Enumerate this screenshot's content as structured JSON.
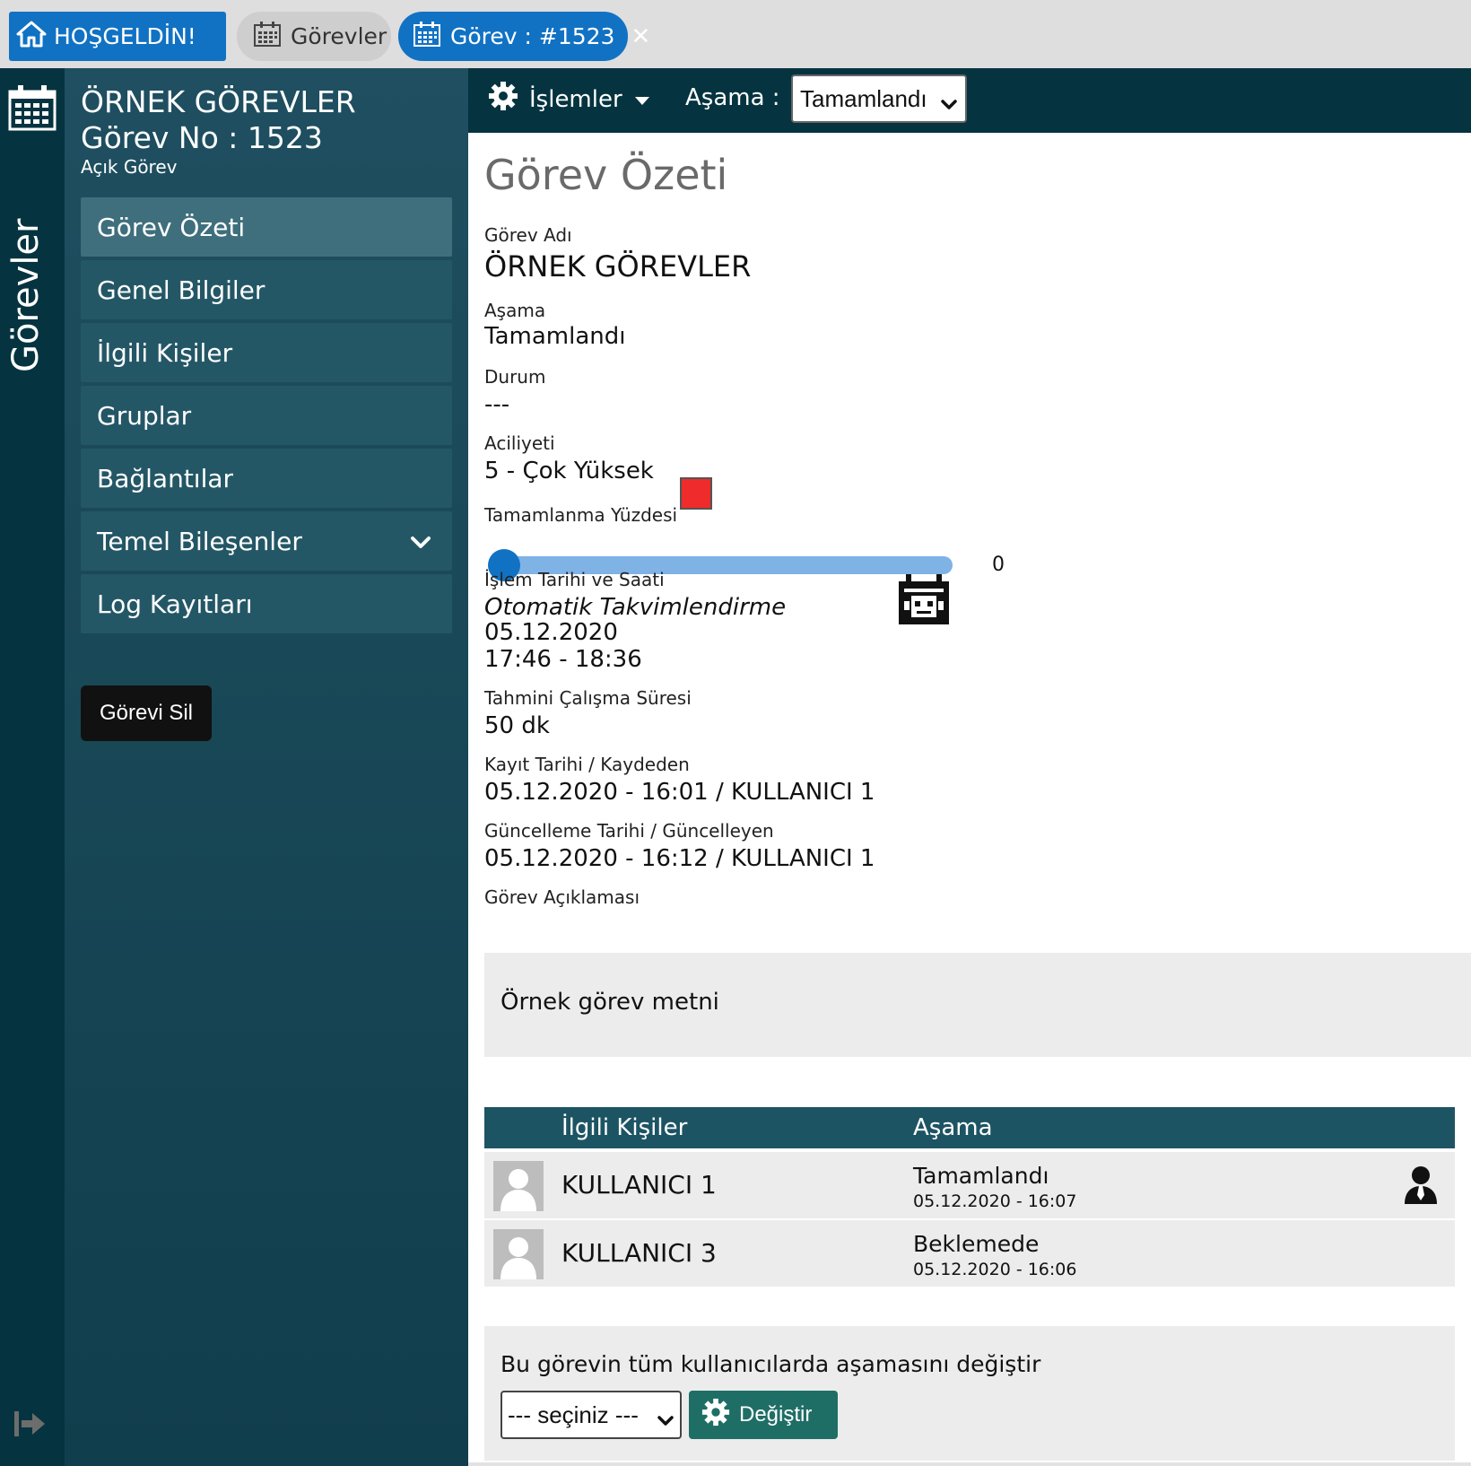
{
  "tabs": {
    "home_label": "HOŞGELDİN!",
    "tasks_label": "Görevler",
    "active_label": "Görev : #1523"
  },
  "rail": {
    "title": "Görevler"
  },
  "sidebar": {
    "task_name": "ÖRNEK GÖREVLER",
    "task_no": "Görev No : 1523",
    "task_state": "Açık Görev",
    "menu": [
      {
        "label": "Görev Özeti"
      },
      {
        "label": "Genel Bilgiler"
      },
      {
        "label": "İlgili Kişiler"
      },
      {
        "label": "Gruplar"
      },
      {
        "label": "Bağlantılar"
      },
      {
        "label": "Temel Bileşenler"
      },
      {
        "label": "Log Kayıtları"
      }
    ],
    "delete_label": "Görevi Sil"
  },
  "actionbar": {
    "ops_label": "İşlemler",
    "stage_label": "Aşama :",
    "stage_value": "Tamamlandı"
  },
  "summary": {
    "title": "Görev Özeti",
    "name_label": "Görev Adı",
    "name_value": "ÖRNEK GÖREVLER",
    "stage_label": "Aşama",
    "stage_value": "Tamamlandı",
    "status_label": "Durum",
    "status_value": "---",
    "urgency_label": "Aciliyeti",
    "urgency_value": "5 - Çok Yüksek",
    "urgency_color": "#ef2b2b",
    "completion_label": "Tamamlanma Yüzdesi",
    "completion_value": "0",
    "datetime_label": "İşlem Tarihi ve Saati",
    "auto_schedule": "Otomatik Takvimlendirme",
    "date_value": "05.12.2020",
    "time_value": "17:46 - 18:36",
    "duration_label": "Tahmini Çalışma Süresi",
    "duration_value": "50 dk",
    "created_label": "Kayıt Tarihi / Kaydeden",
    "created_value": "05.12.2020 - 16:01 / KULLANICI 1",
    "updated_label": "Güncelleme Tarihi / Güncelleyen",
    "updated_value": "05.12.2020 - 16:12 / KULLANICI 1",
    "desc_label": "Görev Açıklaması",
    "desc_value": "Örnek görev metni"
  },
  "people": {
    "header_people": "İlgili Kişiler",
    "header_stage": "Aşama",
    "rows": [
      {
        "name": "KULLANICI 1",
        "stage": "Tamamlandı",
        "date": "05.12.2020 - 16:07"
      },
      {
        "name": "KULLANICI 3",
        "stage": "Beklemede",
        "date": "05.12.2020 - 16:06"
      }
    ]
  },
  "bulk": {
    "text": "Bu görevin tüm kullanıcılarda aşamasını değiştir",
    "select_value": "--- seçiniz ---",
    "button_label": "Değiştir"
  },
  "colors": {
    "accent_blue": "#1172c4",
    "dark_teal": "#053440",
    "button_green": "#1f6e66"
  }
}
